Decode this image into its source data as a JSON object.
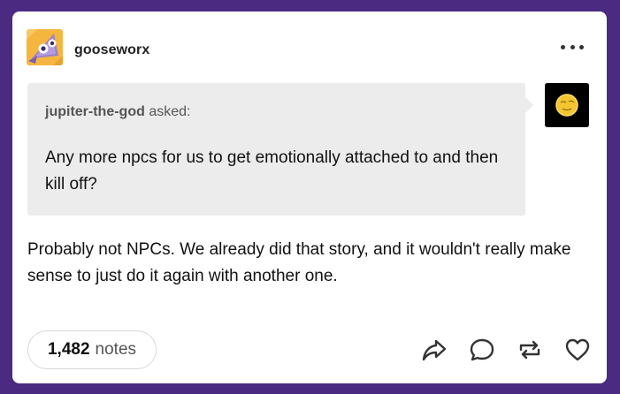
{
  "post": {
    "author": "gooseworx",
    "asker": "jupiter-the-god",
    "asked_label": "asked:",
    "question": "Any more npcs for us to get emotionally attached to and then kill off?",
    "answer": "Probably not NPCs. We already did that story, and it wouldn't really make sense to just do it again with another one.",
    "notes_count": "1,482",
    "notes_label": "notes"
  },
  "colors": {
    "background": "#4b2a82",
    "card": "#ffffff",
    "ask_box": "#ececec"
  },
  "icons": {
    "more": "more-horizontal-icon",
    "share": "share-arrow-icon",
    "reply": "reply-bubble-icon",
    "reblog": "reblog-icon",
    "like": "heart-icon"
  }
}
